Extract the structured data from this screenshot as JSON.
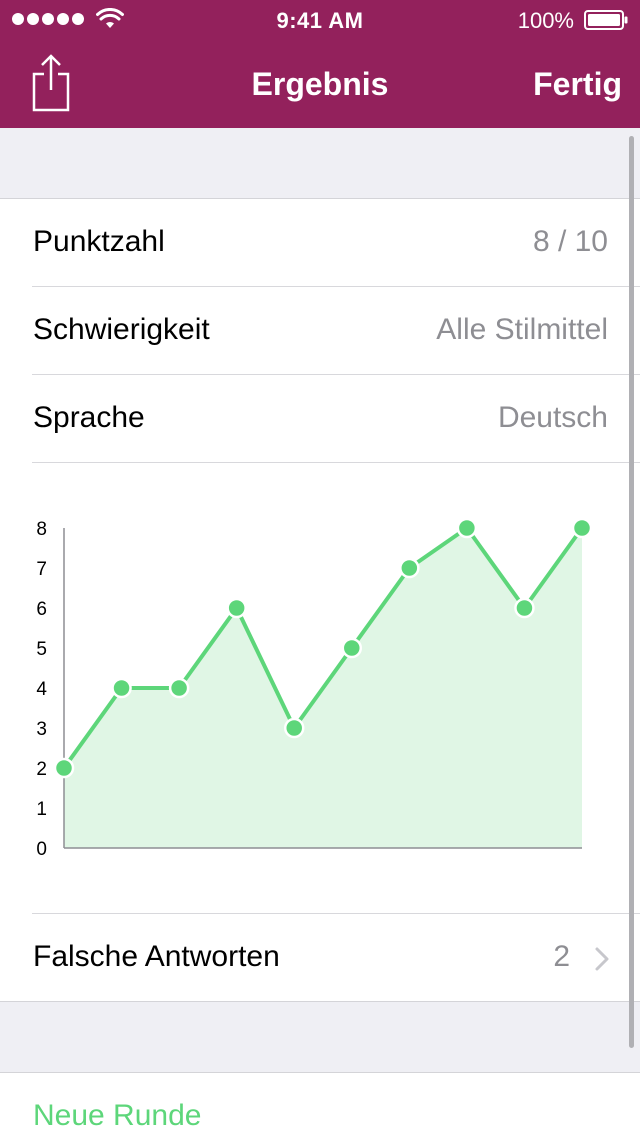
{
  "status": {
    "time": "9:41 AM",
    "battery": "100%"
  },
  "nav": {
    "title": "Ergebnis",
    "done_label": "Fertig"
  },
  "rows": {
    "score_label": "Punktzahl",
    "score_value": "8 / 10",
    "difficulty_label": "Schwierigkeit",
    "difficulty_value": "Alle Stilmittel",
    "language_label": "Sprache",
    "language_value": "Deutsch",
    "wrong_label": "Falsche Antworten",
    "wrong_value": "2"
  },
  "footer": {
    "new_round_label": "Neue Runde"
  },
  "colors": {
    "nav_bar": "#93215c",
    "accent_green": "#5dd67a",
    "chart_fill": "#e0f6e5",
    "secondary_text": "#8e8e93"
  },
  "icons": {
    "share": "share-icon",
    "chevron": "chevron-right-icon",
    "wifi": "wifi-icon",
    "battery": "battery-icon"
  },
  "chart_data": {
    "type": "area",
    "x": [
      1,
      2,
      3,
      4,
      5,
      6,
      7,
      8,
      9,
      10
    ],
    "values": [
      2,
      4,
      4,
      6,
      3,
      5,
      7,
      8,
      6,
      8
    ],
    "ylim": [
      0,
      8
    ],
    "yticks": [
      "0",
      "1",
      "2",
      "3",
      "4",
      "5",
      "6",
      "7",
      "8"
    ],
    "grid": false,
    "title": "",
    "xlabel": "",
    "ylabel": ""
  }
}
